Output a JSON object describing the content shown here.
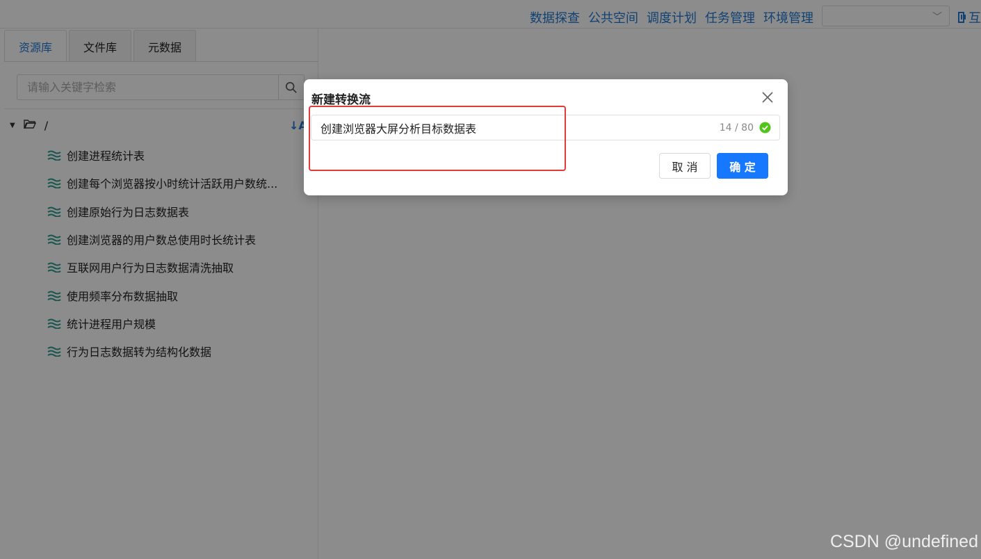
{
  "nav": {
    "items": [
      "数据探查",
      "公共空间",
      "调度计划",
      "任务管理",
      "环境管理"
    ],
    "select_value": "",
    "tail_label": "互"
  },
  "left_panel": {
    "tabs": [
      {
        "label": "资源库",
        "active": true
      },
      {
        "label": "文件库",
        "active": false
      },
      {
        "label": "元数据",
        "active": false
      }
    ],
    "search_placeholder": "请输入关键字检索",
    "root_label": "/",
    "sort_label": "↓A-Z",
    "tree_items": [
      "创建进程统计表",
      "创建每个浏览器按小时统计活跃用户数统...",
      "创建原始行为日志数据表",
      "创建浏览器的用户数总使用时长统计表",
      "互联网用户行为日志数据清洗抽取",
      "使用频率分布数据抽取",
      "统计进程用户规模",
      "行为日志数据转为结构化数据"
    ]
  },
  "modal": {
    "title": "新建转换流",
    "name_value": "创建浏览器大屏分析目标数据表",
    "char_count": "14 / 80",
    "cancel_label": "取 消",
    "confirm_label": "确 定"
  },
  "colors": {
    "accent": "#1f78d1",
    "primary_button": "#1677ff",
    "annotation_red": "#e53935",
    "valid_green": "#52c41a"
  },
  "watermark": "CSDN @undefined"
}
